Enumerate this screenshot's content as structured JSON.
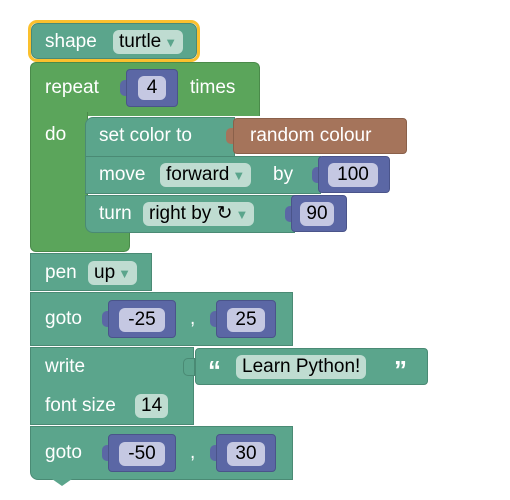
{
  "blocks": {
    "shape": {
      "label": "shape",
      "value": "turtle"
    },
    "repeat": {
      "label": "repeat",
      "count": "4",
      "suffix": "times",
      "do_label": "do"
    },
    "set_color": {
      "label": "set color to",
      "value": "random colour"
    },
    "move": {
      "label": "move",
      "direction": "forward",
      "by_label": "by",
      "amount": "100"
    },
    "turn": {
      "label": "turn",
      "direction": "right by ↻",
      "amount": "90"
    },
    "pen": {
      "label": "pen",
      "value": "up"
    },
    "goto1": {
      "label": "goto",
      "x": "-25",
      "sep": ",",
      "y": "25"
    },
    "write": {
      "label": "write",
      "open_quote": "“",
      "text": "Learn Python!",
      "close_quote": "”",
      "font_label": "font size",
      "font_size": "14"
    },
    "goto2": {
      "label": "goto",
      "x": "-50",
      "sep": ",",
      "y": "30"
    }
  },
  "dropdown_arrow": "▼",
  "colors": {
    "turtle_block": "#5ba58c",
    "loop_block": "#5ba55b",
    "math_block": "#5b67a5",
    "colour_block": "#a5745b",
    "selection": "#fbc02d"
  }
}
